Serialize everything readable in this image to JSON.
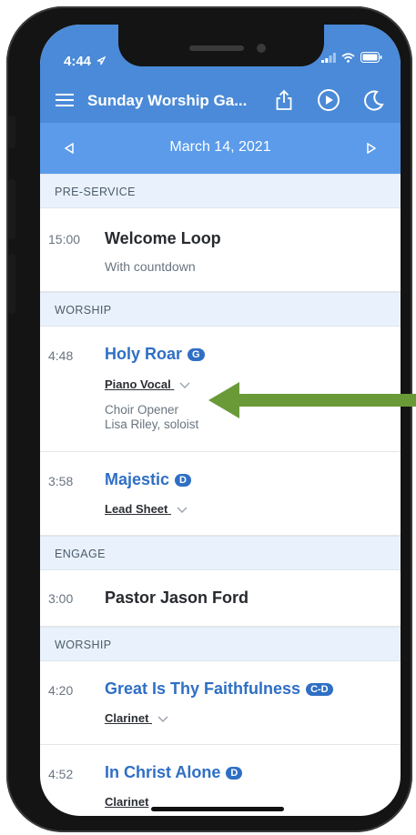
{
  "status": {
    "time": "4:44"
  },
  "header": {
    "title": "Sunday Worship Ga..."
  },
  "date_nav": {
    "date": "March 14, 2021"
  },
  "sections": {
    "pre_service": "PRE-SERVICE",
    "worship1": "WORSHIP",
    "engage": "ENGAGE",
    "worship2": "WORSHIP"
  },
  "items": {
    "welcome": {
      "time": "15:00",
      "title": "Welcome Loop",
      "subtitle": "With countdown"
    },
    "holy_roar": {
      "time": "4:48",
      "title": "Holy Roar",
      "key": "G",
      "arrangement": "Piano Vocal",
      "note1": "Choir Opener",
      "note2": "Lisa Riley, soloist"
    },
    "majestic": {
      "time": "3:58",
      "title": "Majestic",
      "key": "D",
      "arrangement": "Lead Sheet"
    },
    "pastor": {
      "time": "3:00",
      "title": "Pastor Jason Ford"
    },
    "great": {
      "time": "4:20",
      "title": "Great Is Thy Faithfulness",
      "key": "C-D",
      "arrangement": "Clarinet"
    },
    "in_christ": {
      "time": "4:52",
      "title": "In Christ Alone",
      "key": "D",
      "arrangement": "Clarinet"
    }
  },
  "colors": {
    "header_blue": "#4a8ad8",
    "date_bar": "#5b9bea",
    "accent_blue": "#2f6fc4",
    "pointer_green": "#6a9a38"
  }
}
